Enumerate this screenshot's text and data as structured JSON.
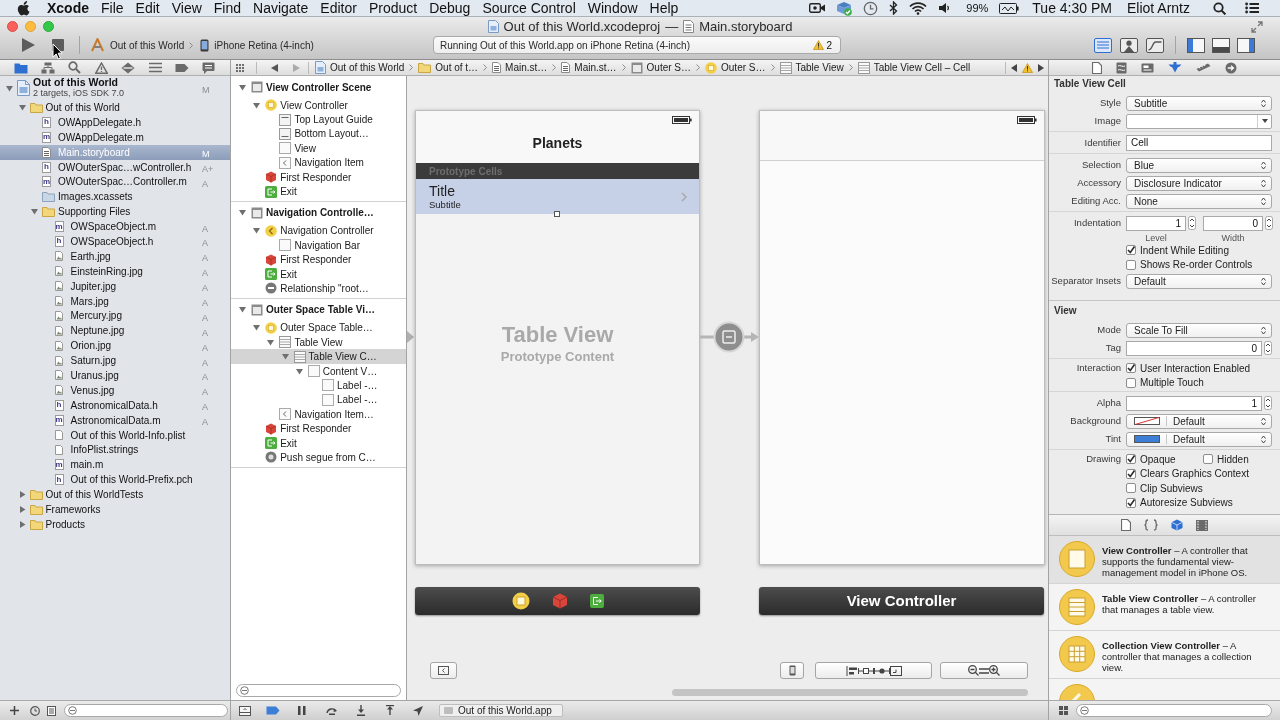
{
  "menu_bar": {
    "app": "Xcode",
    "menus": [
      "File",
      "Edit",
      "View",
      "Find",
      "Navigate",
      "Editor",
      "Product",
      "Debug",
      "Source Control",
      "Window",
      "Help"
    ],
    "battery": "99%",
    "clock": "Tue 4:30 PM",
    "user": "Eliot Arntz"
  },
  "window": {
    "project": "Out of this World.xcodeproj",
    "separator": "—",
    "document": "Main.storyboard"
  },
  "toolbar": {
    "scheme": "Out of this World",
    "destination": "iPhone Retina (4-inch)",
    "activity": "Running Out of this World.app on iPhone Retina (4-inch)",
    "warnings": "2",
    "editor_modes": [
      {
        "selected": true
      },
      {
        "selected": false
      },
      {
        "selected": false
      }
    ],
    "panels": [
      {
        "on": true
      },
      {
        "on": false
      },
      {
        "on": true
      }
    ]
  },
  "navigator": {
    "tabs": [
      {
        "selected": true
      },
      {
        "selected": false
      },
      {
        "selected": false
      },
      {
        "selected": false
      },
      {
        "selected": false
      },
      {
        "selected": false
      },
      {
        "selected": false
      },
      {
        "selected": false
      }
    ],
    "tree": [
      {
        "kind": "project",
        "label": "Out of this World",
        "subtitle": "2 targets, iOS SDK 7.0",
        "badge": "M",
        "selected": false,
        "expanded": true,
        "children": [
          {
            "kind": "folder",
            "label": "Out of this World",
            "selected": false,
            "expanded": true,
            "children": [
              {
                "kind": "source",
                "icon_text": "h",
                "label": "OWAppDelegate.h",
                "selected": false
              },
              {
                "kind": "source",
                "icon_text": "m",
                "label": "OWAppDelegate.m",
                "selected": false
              },
              {
                "kind": "storyboard",
                "label": "Main.storyboard",
                "badge": "M",
                "selected": true
              },
              {
                "kind": "source",
                "icon_text": "h",
                "label": "OWOuterSpac…wController.h",
                "badge": "A+",
                "selected": false
              },
              {
                "kind": "source",
                "icon_text": "m",
                "label": "OWOuterSpac…Controller.m",
                "badge": "A",
                "selected": false
              },
              {
                "kind": "assets",
                "label": "Images.xcassets",
                "selected": false
              },
              {
                "kind": "folder",
                "label": "Supporting Files",
                "selected": false,
                "expanded": true,
                "children": [
                  {
                    "kind": "source",
                    "icon_text": "m",
                    "label": "OWSpaceObject.m",
                    "badge": "A",
                    "selected": false
                  },
                  {
                    "kind": "source",
                    "icon_text": "h",
                    "label": "OWSpaceObject.h",
                    "badge": "A",
                    "selected": false
                  },
                  {
                    "kind": "image",
                    "label": "Earth.jpg",
                    "badge": "A",
                    "selected": false
                  },
                  {
                    "kind": "image",
                    "label": "EinsteinRing.jpg",
                    "badge": "A",
                    "selected": false
                  },
                  {
                    "kind": "image",
                    "label": "Jupiter.jpg",
                    "badge": "A",
                    "selected": false
                  },
                  {
                    "kind": "image",
                    "label": "Mars.jpg",
                    "badge": "A",
                    "selected": false
                  },
                  {
                    "kind": "image",
                    "label": "Mercury.jpg",
                    "badge": "A",
                    "selected": false
                  },
                  {
                    "kind": "image",
                    "label": "Neptune.jpg",
                    "badge": "A",
                    "selected": false
                  },
                  {
                    "kind": "image",
                    "label": "Orion.jpg",
                    "badge": "A",
                    "selected": false
                  },
                  {
                    "kind": "image",
                    "label": "Saturn.jpg",
                    "badge": "A",
                    "selected": false
                  },
                  {
                    "kind": "image",
                    "label": "Uranus.jpg",
                    "badge": "A",
                    "selected": false
                  },
                  {
                    "kind": "image",
                    "label": "Venus.jpg",
                    "badge": "A",
                    "selected": false
                  },
                  {
                    "kind": "source",
                    "icon_text": "h",
                    "label": "AstronomicalData.h",
                    "badge": "A",
                    "selected": false
                  },
                  {
                    "kind": "source",
                    "icon_text": "m",
                    "label": "AstronomicalData.m",
                    "badge": "A",
                    "selected": false
                  },
                  {
                    "kind": "plist",
                    "label": "Out of this World-Info.plist",
                    "selected": false
                  },
                  {
                    "kind": "strings",
                    "label": "InfoPlist.strings",
                    "selected": false
                  },
                  {
                    "kind": "source",
                    "icon_text": "m",
                    "label": "main.m",
                    "selected": false
                  },
                  {
                    "kind": "source",
                    "icon_text": "h",
                    "label": "Out of this World-Prefix.pch",
                    "selected": false
                  }
                ]
              }
            ]
          },
          {
            "kind": "folder",
            "label": "Out of this WorldTests",
            "selected": false,
            "expanded": false
          },
          {
            "kind": "folder",
            "label": "Frameworks",
            "selected": false,
            "expanded": false
          },
          {
            "kind": "folder",
            "label": "Products",
            "selected": false,
            "expanded": false
          }
        ]
      }
    ]
  },
  "jump_bar": {
    "items": [
      {
        "kind": "project",
        "label": "Out of this World"
      },
      {
        "kind": "folder",
        "label": "Out of t…"
      },
      {
        "kind": "storyboard",
        "label": "Main.st…"
      },
      {
        "kind": "storyboard",
        "label": "Main.st…"
      },
      {
        "kind": "scene",
        "label": "Outer S…"
      },
      {
        "kind": "controller",
        "label": "Outer S…"
      },
      {
        "kind": "table",
        "label": "Table View"
      },
      {
        "kind": "table",
        "label": "Table View Cell – Cell"
      }
    ]
  },
  "outline": {
    "tree": [
      {
        "kind": "scene",
        "label": "View Controller Scene",
        "expanded": true,
        "selected": false,
        "children": [
          {
            "kind": "controller",
            "label": "View Controller",
            "expanded": true,
            "selected": false,
            "children": [
              {
                "kind": "top_guide",
                "label": "Top Layout Guide",
                "selected": false
              },
              {
                "kind": "bottom_guide",
                "label": "Bottom Layout…",
                "selected": false
              },
              {
                "kind": "view",
                "label": "View",
                "selected": false
              },
              {
                "kind": "navigation_item",
                "label": "Navigation Item",
                "selected": false
              }
            ]
          },
          {
            "kind": "first_responder",
            "label": "First Responder",
            "selected": false
          },
          {
            "kind": "exit",
            "label": "Exit",
            "selected": false
          }
        ]
      },
      {
        "kind": "scene",
        "label": "Navigation Controlle…",
        "expanded": true,
        "selected": false,
        "children": [
          {
            "kind": "nav_controller",
            "label": "Navigation Controller",
            "expanded": true,
            "selected": false,
            "children": [
              {
                "kind": "view",
                "label": "Navigation Bar",
                "selected": false
              }
            ]
          },
          {
            "kind": "first_responder",
            "label": "First Responder",
            "selected": false
          },
          {
            "kind": "exit",
            "label": "Exit",
            "selected": false
          },
          {
            "kind": "relationship",
            "label": "Relationship \"root…",
            "selected": false
          }
        ]
      },
      {
        "kind": "scene",
        "label": "Outer Space Table Vi…",
        "expanded": true,
        "selected": false,
        "children": [
          {
            "kind": "controller",
            "label": "Outer Space Table…",
            "expanded": true,
            "selected": false,
            "children": [
              {
                "kind": "table",
                "label": "Table View",
                "expanded": true,
                "selected": false,
                "children": [
                  {
                    "kind": "table",
                    "label": "Table View C…",
                    "expanded": true,
                    "selected": true,
                    "children": [
                      {
                        "kind": "view",
                        "label": "Content V…",
                        "expanded": true,
                        "selected": false,
                        "children": [
                          {
                            "kind": "view",
                            "label": "Label -…",
                            "selected": false
                          },
                          {
                            "kind": "view",
                            "label": "Label -…",
                            "selected": false
                          }
                        ]
                      }
                    ]
                  }
                ]
              },
              {
                "kind": "navigation_item",
                "label": "Navigation Item…",
                "selected": false
              }
            ]
          },
          {
            "kind": "first_responder",
            "label": "First Responder",
            "selected": false
          },
          {
            "kind": "exit",
            "label": "Exit",
            "selected": false
          },
          {
            "kind": "push_segue",
            "label": "Push segue from C…",
            "selected": false
          }
        ]
      }
    ]
  },
  "canvas": {
    "scenes": [
      {
        "kind": "table",
        "nav_title": "Planets",
        "section_header": "Prototype Cells",
        "cell": {
          "title": "Title",
          "subtitle": "Subtitle",
          "selected": true
        },
        "placeholder_title": "Table View",
        "placeholder_subtitle": "Prototype Content",
        "dock": {
          "kind": "icons"
        }
      },
      {
        "kind": "view",
        "dock": {
          "kind": "title",
          "title": "View Controller"
        }
      }
    ]
  },
  "inspector": {
    "tabs": [
      {
        "selected": false
      },
      {
        "selected": false
      },
      {
        "selected": false
      },
      {
        "selected": true
      },
      {
        "selected": false
      },
      {
        "selected": false
      }
    ],
    "sections": [
      {
        "title": "Table View Cell",
        "groups": [
          {
            "rows": [
              {
                "kind": "popup",
                "label": "Style",
                "value": "Subtitle"
              },
              {
                "kind": "combo",
                "label": "Image"
              }
            ]
          },
          {
            "rows": [
              {
                "kind": "text",
                "label": "Identifier",
                "value": "Cell"
              }
            ]
          },
          {
            "rows": [
              {
                "kind": "popup",
                "label": "Selection",
                "value": "Blue"
              },
              {
                "kind": "popup",
                "label": "Accessory",
                "value": "Disclosure Indicator"
              },
              {
                "kind": "popup",
                "label": "Editing Acc.",
                "value": "None"
              }
            ]
          },
          {
            "rows": [
              {
                "kind": "steppers",
                "label": "Indentation",
                "fields": [
                  {
                    "value": "1",
                    "caption": "Level"
                  },
                  {
                    "value": "0",
                    "caption": "Width"
                  }
                ]
              },
              {
                "kind": "checkboxes",
                "options": [
                  {
                    "label": "Indent While Editing",
                    "checked": true
                  }
                ]
              },
              {
                "kind": "checkboxes",
                "options": [
                  {
                    "label": "Shows Re-order Controls",
                    "checked": false
                  }
                ]
              },
              {
                "kind": "popup",
                "label": "Separator Insets",
                "value": "Default"
              }
            ]
          }
        ]
      },
      {
        "title": "View",
        "groups": [
          {
            "rows": [
              {
                "kind": "popup",
                "label": "Mode",
                "value": "Scale To Fill"
              },
              {
                "kind": "stepper",
                "label": "Tag",
                "value": "0"
              }
            ]
          },
          {
            "rows": [
              {
                "kind": "checkboxes",
                "label": "Interaction",
                "options": [
                  {
                    "label": "User Interaction Enabled",
                    "checked": true
                  }
                ]
              },
              {
                "kind": "checkboxes",
                "options": [
                  {
                    "label": "Multiple Touch",
                    "checked": false
                  }
                ]
              }
            ]
          },
          {
            "rows": [
              {
                "kind": "stepper",
                "label": "Alpha",
                "value": "1"
              },
              {
                "kind": "color",
                "label": "Background",
                "value": "Default",
                "clear": true
              },
              {
                "kind": "color",
                "label": "Tint",
                "value": "Default",
                "clear": false,
                "color": "#3d7fd6"
              }
            ]
          },
          {
            "rows": [
              {
                "kind": "checkboxes",
                "label": "Drawing",
                "options": [
                  {
                    "label": "Opaque",
                    "checked": true
                  },
                  {
                    "label": "Hidden",
                    "checked": false
                  }
                ]
              },
              {
                "kind": "checkboxes",
                "options": [
                  {
                    "label": "Clears Graphics Context",
                    "checked": true
                  }
                ]
              },
              {
                "kind": "checkboxes",
                "options": [
                  {
                    "label": "Clip Subviews",
                    "checked": false
                  }
                ]
              },
              {
                "kind": "checkboxes",
                "options": [
                  {
                    "label": "Autoresize Subviews",
                    "checked": true
                  }
                ]
              }
            ]
          }
        ]
      }
    ]
  },
  "library": {
    "tabs": [
      {
        "selected": false
      },
      {
        "selected": false
      },
      {
        "selected": true
      },
      {
        "selected": false
      }
    ],
    "items": [
      {
        "kind": "view_controller",
        "text": "**View Controller** – A controller that supports the fundamental view-management model in iPhone OS.",
        "selected": true
      },
      {
        "kind": "table_view_controller",
        "text": "**Table View Controller** – A controller that manages a table view.",
        "selected": false
      },
      {
        "kind": "collection_view_controller",
        "text": "**Collection View Controller** – A controller that manages a collection view.",
        "selected": false
      },
      {
        "kind": "navigation_controller",
        "selected": false
      }
    ]
  },
  "debug_bar": {
    "breakpoints_active": true,
    "process": "Out of this World.app"
  }
}
